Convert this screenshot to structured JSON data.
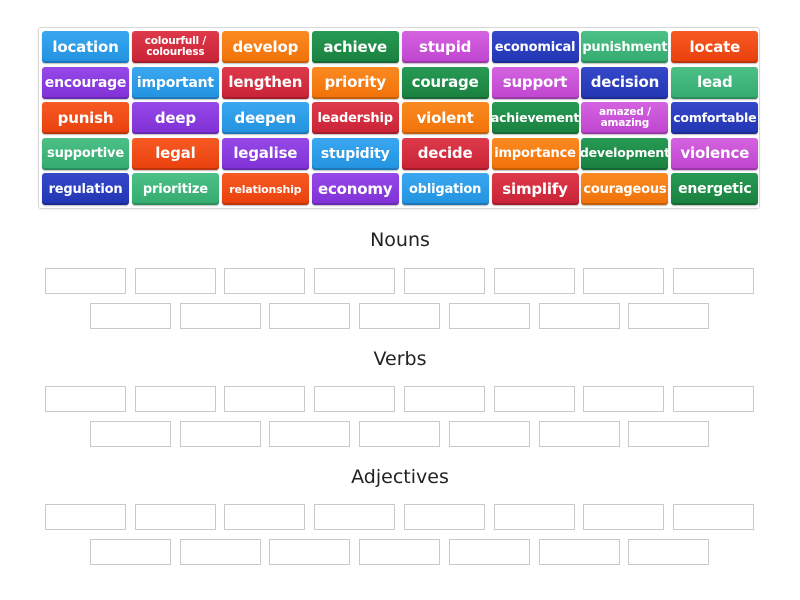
{
  "tiles": [
    {
      "label": "location",
      "color": "blue"
    },
    {
      "label": "colourfull / colourless",
      "color": "red"
    },
    {
      "label": "develop",
      "color": "orange"
    },
    {
      "label": "achieve",
      "color": "darkgreen"
    },
    {
      "label": "stupid",
      "color": "magenta"
    },
    {
      "label": "economical",
      "color": "navy"
    },
    {
      "label": "punishment",
      "color": "teal"
    },
    {
      "label": "locate",
      "color": "redorange"
    },
    {
      "label": "encourage",
      "color": "purple"
    },
    {
      "label": "important",
      "color": "blue"
    },
    {
      "label": "lengthen",
      "color": "red"
    },
    {
      "label": "priority",
      "color": "orange"
    },
    {
      "label": "courage",
      "color": "darkgreen"
    },
    {
      "label": "support",
      "color": "magenta"
    },
    {
      "label": "decision",
      "color": "navy"
    },
    {
      "label": "lead",
      "color": "teal"
    },
    {
      "label": "punish",
      "color": "redorange"
    },
    {
      "label": "deep",
      "color": "purple"
    },
    {
      "label": "deepen",
      "color": "blue"
    },
    {
      "label": "leadership",
      "color": "red"
    },
    {
      "label": "violent",
      "color": "orange"
    },
    {
      "label": "achievement",
      "color": "darkgreen"
    },
    {
      "label": "amazed / amazing",
      "color": "magenta"
    },
    {
      "label": "comfortable",
      "color": "navy"
    },
    {
      "label": "supportive",
      "color": "teal"
    },
    {
      "label": "legal",
      "color": "redorange"
    },
    {
      "label": "legalise",
      "color": "purple"
    },
    {
      "label": "stupidity",
      "color": "blue"
    },
    {
      "label": "decide",
      "color": "red"
    },
    {
      "label": "importance",
      "color": "orange"
    },
    {
      "label": "development",
      "color": "darkgreen"
    },
    {
      "label": "violence",
      "color": "magenta"
    },
    {
      "label": "regulation",
      "color": "navy"
    },
    {
      "label": "prioritize",
      "color": "teal"
    },
    {
      "label": "relationship",
      "color": "redorange"
    },
    {
      "label": "economy",
      "color": "purple"
    },
    {
      "label": "obligation",
      "color": "blue"
    },
    {
      "label": "simplify",
      "color": "red"
    },
    {
      "label": "courageous",
      "color": "orange"
    },
    {
      "label": "energetic",
      "color": "darkgreen"
    }
  ],
  "palette": {
    "blue": "#2e9be8",
    "red": "#d42c3e",
    "orange": "#f57c12",
    "darkgreen": "#1f8a4a",
    "magenta": "#c854d6",
    "navy": "#2b3fbf",
    "teal": "#3cb37a",
    "redorange": "#f04a14",
    "purple": "#8a3be0"
  },
  "groups": [
    {
      "title": "Nouns",
      "slot_count": 15
    },
    {
      "title": "Verbs",
      "slot_count": 15
    },
    {
      "title": "Adjectives",
      "slot_count": 15
    }
  ]
}
